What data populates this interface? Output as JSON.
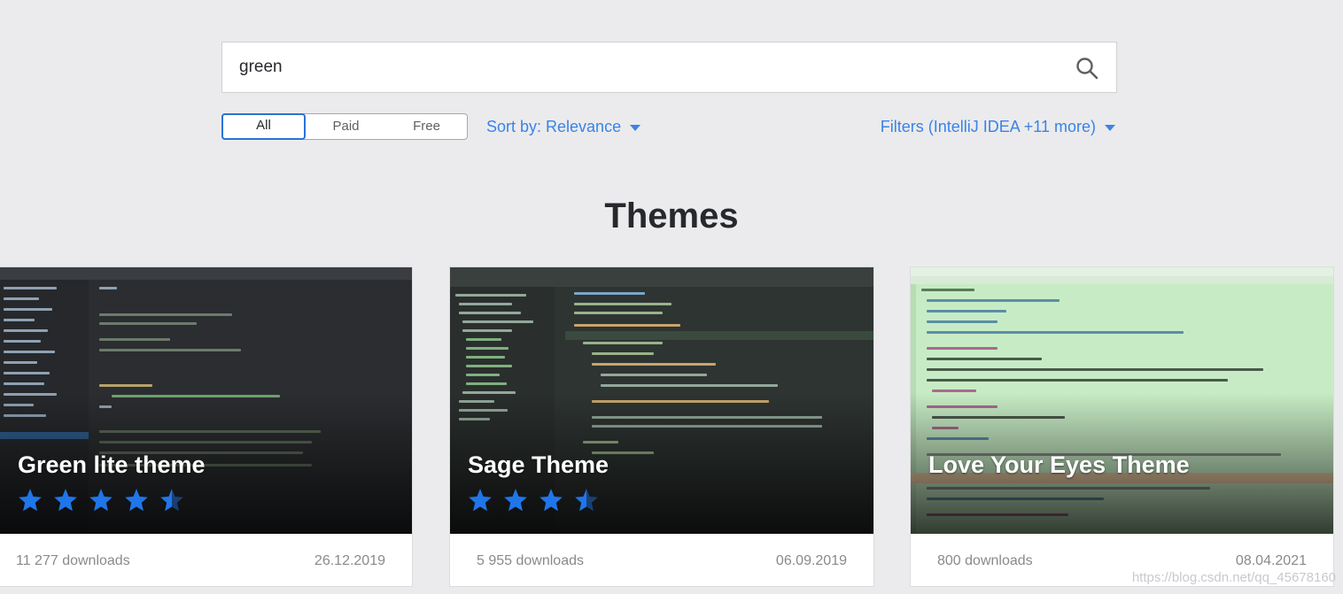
{
  "search": {
    "value": "green",
    "icon": "search-icon"
  },
  "pricing_filter": {
    "options": [
      "All",
      "Paid",
      "Free"
    ],
    "selected": "All"
  },
  "sort": {
    "label": "Sort by: Relevance"
  },
  "filters": {
    "label": "Filters (IntelliJ IDEA +11 more)"
  },
  "section_title": "Themes",
  "colors": {
    "accent": "#3a83e6",
    "star": "#1f76ea",
    "background": "#ebebed"
  },
  "cards": [
    {
      "title": "Green lite theme",
      "rating": 4.5,
      "downloads": "11 277 downloads",
      "date": "26.12.2019"
    },
    {
      "title": "Sage Theme",
      "rating": 3.5,
      "downloads": "5 955 downloads",
      "date": "06.09.2019"
    },
    {
      "title": "Love Your Eyes Theme",
      "downloads": "800 downloads",
      "date": "08.04.2021"
    }
  ],
  "watermark": "https://blog.csdn.net/qq_45678160"
}
